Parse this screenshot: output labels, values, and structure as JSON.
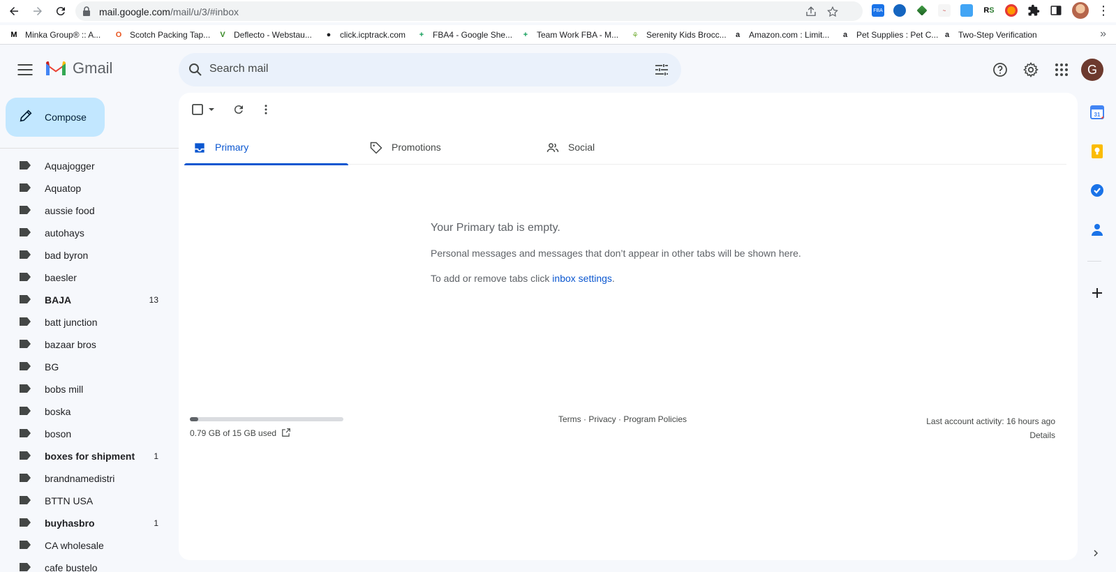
{
  "browser": {
    "url_host": "mail.google.com",
    "url_path": "/mail/u/3/#inbox",
    "bookmarks": [
      {
        "label": "Minka Group® :: A...",
        "icon": "minka-icon",
        "glyph": "M",
        "color": "#000000"
      },
      {
        "label": "Scotch Packing Tap...",
        "icon": "office-depot-icon",
        "glyph": "O",
        "color": "#e8541e"
      },
      {
        "label": "Deflecto - Webstau...",
        "icon": "deflecto-icon",
        "glyph": "V",
        "color": "#3a8a28"
      },
      {
        "label": "click.icptrack.com",
        "icon": "globe-icon",
        "glyph": "●",
        "color": "#202124"
      },
      {
        "label": "FBA4 - Google She...",
        "icon": "sheets-icon",
        "glyph": "+",
        "color": "#0f9d58"
      },
      {
        "label": "Team Work FBA - M...",
        "icon": "sheets-icon",
        "glyph": "+",
        "color": "#0f9d58"
      },
      {
        "label": "Serenity Kids Brocc...",
        "icon": "serenity-icon",
        "glyph": "⚘",
        "color": "#7cb342"
      },
      {
        "label": "Amazon.com : Limit...",
        "icon": "amazon-icon",
        "glyph": "a",
        "color": "#202124"
      },
      {
        "label": "Pet Supplies : Pet C...",
        "icon": "amazon-icon",
        "glyph": "a",
        "color": "#202124"
      },
      {
        "label": "Two-Step Verification",
        "icon": "amazon-icon",
        "glyph": "a",
        "color": "#202124"
      }
    ],
    "more_bookmarks": "»"
  },
  "header": {
    "logo_text": "Gmail",
    "search_placeholder": "Search mail",
    "account_initial": "G"
  },
  "sidebar": {
    "compose_label": "Compose",
    "labels": [
      {
        "name": "Aquajogger",
        "count": "",
        "bold": false
      },
      {
        "name": "Aquatop",
        "count": "",
        "bold": false
      },
      {
        "name": "aussie food",
        "count": "",
        "bold": false
      },
      {
        "name": "autohays",
        "count": "",
        "bold": false
      },
      {
        "name": "bad byron",
        "count": "",
        "bold": false
      },
      {
        "name": "baesler",
        "count": "",
        "bold": false
      },
      {
        "name": "BAJA",
        "count": "13",
        "bold": true
      },
      {
        "name": "batt junction",
        "count": "",
        "bold": false
      },
      {
        "name": "bazaar bros",
        "count": "",
        "bold": false
      },
      {
        "name": "BG",
        "count": "",
        "bold": false
      },
      {
        "name": "bobs mill",
        "count": "",
        "bold": false
      },
      {
        "name": "boska",
        "count": "",
        "bold": false
      },
      {
        "name": "boson",
        "count": "",
        "bold": false
      },
      {
        "name": "boxes for shipment",
        "count": "1",
        "bold": true
      },
      {
        "name": "brandnamedistri",
        "count": "",
        "bold": false
      },
      {
        "name": "BTTN USA",
        "count": "",
        "bold": false
      },
      {
        "name": "buyhasbro",
        "count": "1",
        "bold": true
      },
      {
        "name": "CA wholesale",
        "count": "",
        "bold": false
      },
      {
        "name": "cafe bustelo",
        "count": "",
        "bold": false
      }
    ]
  },
  "main": {
    "tabs": [
      {
        "label": "Primary",
        "icon": "inbox-icon",
        "active": true
      },
      {
        "label": "Promotions",
        "icon": "tag-icon",
        "active": false
      },
      {
        "label": "Social",
        "icon": "people-icon",
        "active": false
      }
    ],
    "empty_title": "Your Primary tab is empty.",
    "empty_line1": "Personal messages and messages that don’t appear in other tabs will be shown here.",
    "empty_line2_prefix": "To add or remove tabs click ",
    "empty_line2_link": "inbox settings",
    "empty_line2_suffix": "."
  },
  "footer": {
    "storage_text": "0.79 GB of 15 GB used",
    "storage_fraction": 0.053,
    "links": "Terms · Privacy · Program Policies",
    "activity": "Last account activity: 16 hours ago",
    "details": "Details"
  },
  "side_panel": {
    "calendar_day": "31"
  },
  "colors": {
    "accent": "#0b57d0",
    "compose_bg": "#c2e7ff",
    "search_bg": "#eaf1fb"
  }
}
